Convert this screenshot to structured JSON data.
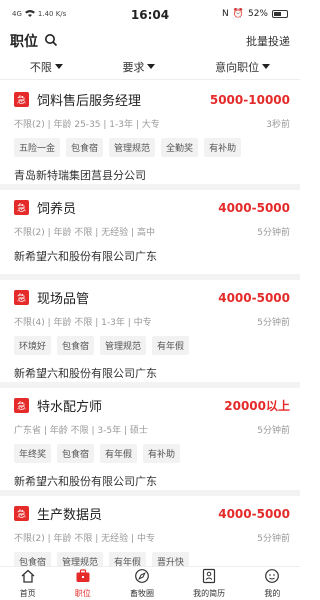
{
  "status_bar": {
    "signal": "4G",
    "speed": "1.40 K/s",
    "time": "16:04",
    "battery": "52%"
  },
  "header": {
    "title": "职位",
    "batch_post_label": "批量投递"
  },
  "filters": [
    {
      "label": "不限"
    },
    {
      "label": "要求"
    },
    {
      "label": "意向职位"
    }
  ],
  "jobs": [
    {
      "title": "饲料售后服务经理",
      "salary": "5000-10000",
      "meta": [
        "不限(2)",
        "年龄 25-35",
        "1-3年",
        "大专"
      ],
      "time": "3秒前",
      "tags": [
        "五险一金",
        "包食宿",
        "管理规范",
        "全勤奖",
        "有补助"
      ],
      "company": "青岛新特瑞集团莒县分公司"
    },
    {
      "title": "饲养员",
      "salary": "4000-5000",
      "meta": [
        "不限(2)",
        "年龄 不限",
        "无经验",
        "高中"
      ],
      "time": "5分钟前",
      "tags": [],
      "company": "新希望六和股份有限公司广东"
    },
    {
      "title": "现场品管",
      "salary": "4000-5000",
      "meta": [
        "不限(4)",
        "年龄 不限",
        "1-3年",
        "中专"
      ],
      "time": "5分钟前",
      "tags": [
        "环境好",
        "包食宿",
        "管理规范",
        "有年假"
      ],
      "company": "新希望六和股份有限公司广东"
    },
    {
      "title": "特水配方师",
      "salary": "20000以上",
      "meta": [
        "广东省",
        "年龄 不限",
        "3-5年",
        "硕士"
      ],
      "time": "5分钟前",
      "tags": [
        "年终奖",
        "包食宿",
        "有年假",
        "有补助"
      ],
      "company": "新希望六和股份有限公司广东"
    },
    {
      "title": "生产数据员",
      "salary": "4000-5000",
      "meta": [
        "不限(2)",
        "年龄 不限",
        "无经验",
        "中专"
      ],
      "time": "5分钟前",
      "tags": [
        "包食宿",
        "管理规范",
        "有年假",
        "晋升快"
      ],
      "company": ""
    }
  ],
  "tabbar": [
    {
      "label": "首页",
      "icon": "home-icon"
    },
    {
      "label": "职位",
      "icon": "briefcase-icon"
    },
    {
      "label": "畜牧圈",
      "icon": "compass-icon"
    },
    {
      "label": "我的简历",
      "icon": "resume-icon"
    },
    {
      "label": "我的",
      "icon": "profile-icon"
    }
  ],
  "urgent_label": "急",
  "accent_color": "#e52a2a"
}
